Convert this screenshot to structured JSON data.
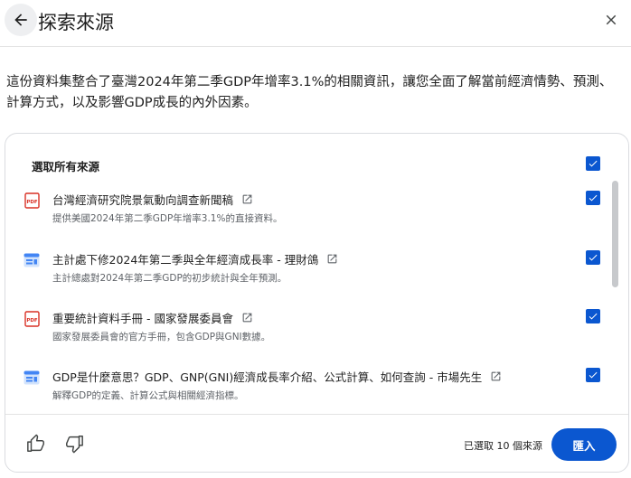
{
  "header": {
    "title": "探索來源",
    "back_icon": "arrow-back-icon",
    "close_icon": "close-icon"
  },
  "description": "這份資料集整合了臺灣2024年第二季GDP年增率3.1%的相關資訊，讓您全面了解當前經濟情勢、預測、計算方式，以及影響GDP成長的內外因素。",
  "panel": {
    "select_all_label": "選取所有來源",
    "select_all_checked": true,
    "sources": [
      {
        "icon": "pdf-icon",
        "title": "台灣經濟研究院景氣動向調查新聞稿",
        "subtitle": "提供美國2024年第二季GDP年增率3.1%的直接資料。",
        "checked": true
      },
      {
        "icon": "web-icon",
        "title": "主計處下修2024年第二季與全年經濟成長率 - 理財鴿",
        "subtitle": "主計總處對2024年第二季GDP的初步統計與全年預測。",
        "checked": true
      },
      {
        "icon": "pdf-icon",
        "title": "重要統計資料手冊 - 國家發展委員會",
        "subtitle": "國家發展委員會的官方手冊，包含GDP與GNI數據。",
        "checked": true
      },
      {
        "icon": "web-icon",
        "title": "GDP是什麼意思？GDP、GNP(GNI)經濟成長率介紹、公式計算、如何查詢 - 市場先生",
        "subtitle": "解釋GDP的定義、計算公式與相關經濟指標。",
        "checked": true
      }
    ]
  },
  "footer": {
    "selected_count_text": "已選取 10 個來源",
    "import_label": "匯入",
    "thumbs_up_icon": "thumbs-up-icon",
    "thumbs_down_icon": "thumbs-down-icon"
  },
  "colors": {
    "accent": "#0b57d0",
    "pdf_red": "#d93025",
    "web_blue": "#4285f4",
    "muted_text": "#5f6368"
  }
}
